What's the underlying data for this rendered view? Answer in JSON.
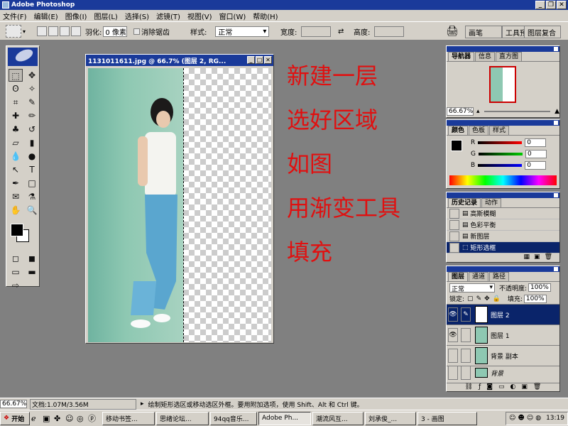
{
  "app": {
    "title": "Adobe Photoshop"
  },
  "menu": [
    "文件(F)",
    "编辑(E)",
    "图像(I)",
    "图层(L)",
    "选择(S)",
    "滤镜(T)",
    "视图(V)",
    "窗口(W)",
    "帮助(H)"
  ],
  "options": {
    "feather_label": "羽化:",
    "feather_value": "0 像素",
    "antialias_label": "消除锯齿",
    "style_label": "样式:",
    "style_value": "正常",
    "width_label": "宽度:",
    "height_label": "高度:"
  },
  "palette_well": [
    "画笔",
    "工具预设",
    "图层复合"
  ],
  "document": {
    "title": "1131011611.jpg @ 66.7% (图层 2, RG..."
  },
  "overlay_text": [
    "新建一层",
    "选好区域",
    "如图",
    "用渐变工具",
    "填充"
  ],
  "navigator": {
    "tabs": [
      "导航器",
      "信息",
      "直方图"
    ],
    "zoom": "66.67%"
  },
  "color_panel": {
    "tabs": [
      "颜色",
      "色板",
      "样式"
    ],
    "r": "0",
    "g": "0",
    "b": "0"
  },
  "history": {
    "tabs": [
      "历史记录",
      "动作"
    ],
    "items": [
      "高斯模糊",
      "色彩平衡",
      "新图层",
      "矩形选框"
    ]
  },
  "layers": {
    "tabs": [
      "图层",
      "通道",
      "路径"
    ],
    "blend": "正常",
    "opacity_label": "不透明度:",
    "opacity": "100%",
    "lock_label": "锁定:",
    "fill_label": "填充:",
    "fill": "100%",
    "items": [
      "图层 2",
      "图层 1",
      "背景 副本",
      "背景"
    ]
  },
  "status": {
    "zoom": "66.67%",
    "doc": "文档:1.07M/3.56M",
    "hint": "绘制矩形选区或移动选区外框。要用附加选项，使用 Shift、Alt 和 Ctrl 键。"
  },
  "taskbar": {
    "start": "开始",
    "items": [
      "移动书签...",
      "思绪论坛...",
      "94qq音乐...",
      "Adobe Ph...",
      "潮流风互...",
      "刘承俊_...",
      "3 - 画图"
    ],
    "clock": "13:19"
  },
  "colors": {
    "titlebar": "#1a3a9a",
    "overlay": "#e01010",
    "selected": "#0a246a"
  }
}
